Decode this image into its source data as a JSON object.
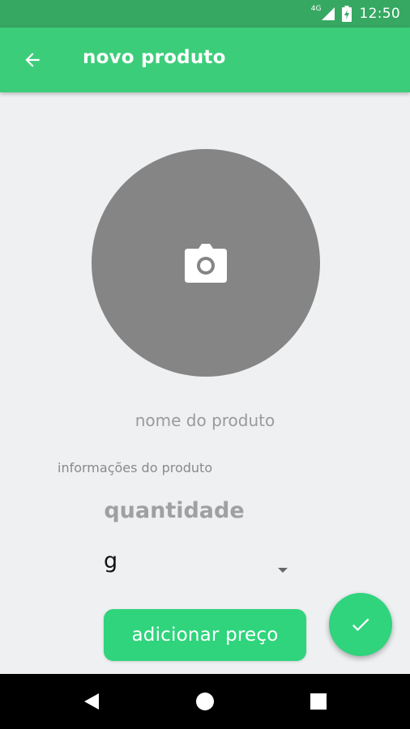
{
  "status_bar": {
    "network": "4G",
    "time": "12:50",
    "icons": [
      "signal-icon",
      "battery-charging-icon"
    ]
  },
  "app_bar": {
    "title": "novo produto",
    "back_icon": "arrow-back-icon",
    "background_color": "#3ccd7a"
  },
  "photo_picker": {
    "icon": "camera-icon",
    "background_color": "#858585"
  },
  "form": {
    "name_placeholder": "nome do produto",
    "name_value": "",
    "info_placeholder": "informações do produto",
    "info_value": "",
    "quantity_placeholder": "quantidade",
    "quantity_value": "",
    "unit_selected": "g"
  },
  "actions": {
    "add_price_label": "adicionar preço",
    "confirm_icon": "check-icon",
    "accent_color": "#2fd47c"
  },
  "nav_bar": {
    "icons": [
      "nav-back-icon",
      "nav-home-icon",
      "nav-recents-icon"
    ]
  }
}
